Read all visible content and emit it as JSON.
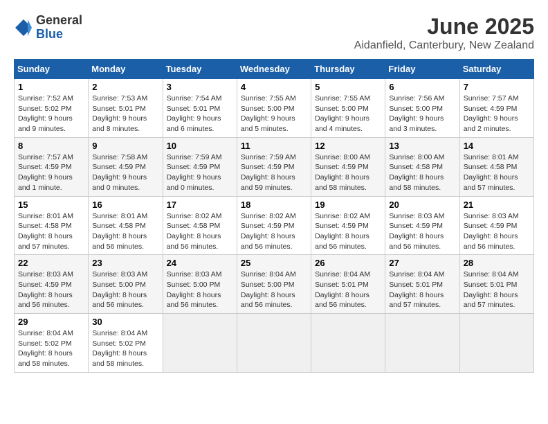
{
  "logo": {
    "general": "General",
    "blue": "Blue"
  },
  "title": "June 2025",
  "subtitle": "Aidanfield, Canterbury, New Zealand",
  "weekdays": [
    "Sunday",
    "Monday",
    "Tuesday",
    "Wednesday",
    "Thursday",
    "Friday",
    "Saturday"
  ],
  "weeks": [
    [
      {
        "day": "1",
        "info": "Sunrise: 7:52 AM\nSunset: 5:02 PM\nDaylight: 9 hours and 9 minutes."
      },
      {
        "day": "2",
        "info": "Sunrise: 7:53 AM\nSunset: 5:01 PM\nDaylight: 9 hours and 8 minutes."
      },
      {
        "day": "3",
        "info": "Sunrise: 7:54 AM\nSunset: 5:01 PM\nDaylight: 9 hours and 6 minutes."
      },
      {
        "day": "4",
        "info": "Sunrise: 7:55 AM\nSunset: 5:00 PM\nDaylight: 9 hours and 5 minutes."
      },
      {
        "day": "5",
        "info": "Sunrise: 7:55 AM\nSunset: 5:00 PM\nDaylight: 9 hours and 4 minutes."
      },
      {
        "day": "6",
        "info": "Sunrise: 7:56 AM\nSunset: 5:00 PM\nDaylight: 9 hours and 3 minutes."
      },
      {
        "day": "7",
        "info": "Sunrise: 7:57 AM\nSunset: 4:59 PM\nDaylight: 9 hours and 2 minutes."
      }
    ],
    [
      {
        "day": "8",
        "info": "Sunrise: 7:57 AM\nSunset: 4:59 PM\nDaylight: 9 hours and 1 minute."
      },
      {
        "day": "9",
        "info": "Sunrise: 7:58 AM\nSunset: 4:59 PM\nDaylight: 9 hours and 0 minutes."
      },
      {
        "day": "10",
        "info": "Sunrise: 7:59 AM\nSunset: 4:59 PM\nDaylight: 9 hours and 0 minutes."
      },
      {
        "day": "11",
        "info": "Sunrise: 7:59 AM\nSunset: 4:59 PM\nDaylight: 8 hours and 59 minutes."
      },
      {
        "day": "12",
        "info": "Sunrise: 8:00 AM\nSunset: 4:59 PM\nDaylight: 8 hours and 58 minutes."
      },
      {
        "day": "13",
        "info": "Sunrise: 8:00 AM\nSunset: 4:58 PM\nDaylight: 8 hours and 58 minutes."
      },
      {
        "day": "14",
        "info": "Sunrise: 8:01 AM\nSunset: 4:58 PM\nDaylight: 8 hours and 57 minutes."
      }
    ],
    [
      {
        "day": "15",
        "info": "Sunrise: 8:01 AM\nSunset: 4:58 PM\nDaylight: 8 hours and 57 minutes."
      },
      {
        "day": "16",
        "info": "Sunrise: 8:01 AM\nSunset: 4:58 PM\nDaylight: 8 hours and 56 minutes."
      },
      {
        "day": "17",
        "info": "Sunrise: 8:02 AM\nSunset: 4:58 PM\nDaylight: 8 hours and 56 minutes."
      },
      {
        "day": "18",
        "info": "Sunrise: 8:02 AM\nSunset: 4:59 PM\nDaylight: 8 hours and 56 minutes."
      },
      {
        "day": "19",
        "info": "Sunrise: 8:02 AM\nSunset: 4:59 PM\nDaylight: 8 hours and 56 minutes."
      },
      {
        "day": "20",
        "info": "Sunrise: 8:03 AM\nSunset: 4:59 PM\nDaylight: 8 hours and 56 minutes."
      },
      {
        "day": "21",
        "info": "Sunrise: 8:03 AM\nSunset: 4:59 PM\nDaylight: 8 hours and 56 minutes."
      }
    ],
    [
      {
        "day": "22",
        "info": "Sunrise: 8:03 AM\nSunset: 4:59 PM\nDaylight: 8 hours and 56 minutes."
      },
      {
        "day": "23",
        "info": "Sunrise: 8:03 AM\nSunset: 5:00 PM\nDaylight: 8 hours and 56 minutes."
      },
      {
        "day": "24",
        "info": "Sunrise: 8:03 AM\nSunset: 5:00 PM\nDaylight: 8 hours and 56 minutes."
      },
      {
        "day": "25",
        "info": "Sunrise: 8:04 AM\nSunset: 5:00 PM\nDaylight: 8 hours and 56 minutes."
      },
      {
        "day": "26",
        "info": "Sunrise: 8:04 AM\nSunset: 5:01 PM\nDaylight: 8 hours and 56 minutes."
      },
      {
        "day": "27",
        "info": "Sunrise: 8:04 AM\nSunset: 5:01 PM\nDaylight: 8 hours and 57 minutes."
      },
      {
        "day": "28",
        "info": "Sunrise: 8:04 AM\nSunset: 5:01 PM\nDaylight: 8 hours and 57 minutes."
      }
    ],
    [
      {
        "day": "29",
        "info": "Sunrise: 8:04 AM\nSunset: 5:02 PM\nDaylight: 8 hours and 58 minutes."
      },
      {
        "day": "30",
        "info": "Sunrise: 8:04 AM\nSunset: 5:02 PM\nDaylight: 8 hours and 58 minutes."
      },
      {
        "day": "",
        "info": ""
      },
      {
        "day": "",
        "info": ""
      },
      {
        "day": "",
        "info": ""
      },
      {
        "day": "",
        "info": ""
      },
      {
        "day": "",
        "info": ""
      }
    ]
  ]
}
